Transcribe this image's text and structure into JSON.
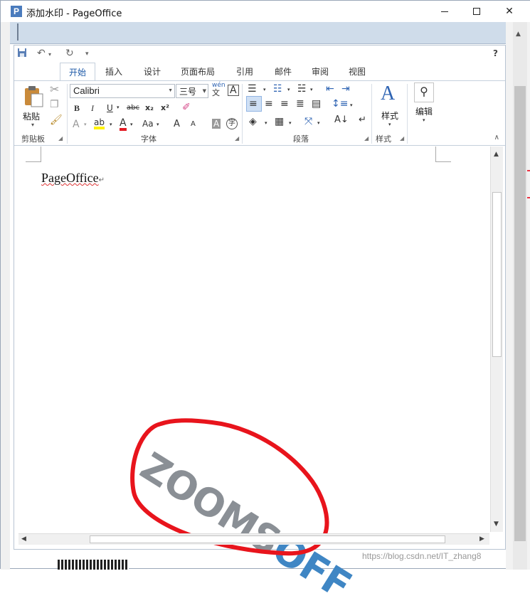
{
  "window": {
    "title": "添加水印 - PageOffice",
    "app_icon_letter": "P"
  },
  "qat": {
    "save_icon": "save-icon",
    "undo_icon": "undo-icon",
    "redo_icon": "redo-icon",
    "customize_icon": "customize-qat-icon",
    "help_label": "?"
  },
  "tabs": [
    {
      "label": "开始",
      "active": true
    },
    {
      "label": "插入"
    },
    {
      "label": "设计"
    },
    {
      "label": "页面布局"
    },
    {
      "label": "引用"
    },
    {
      "label": "邮件"
    },
    {
      "label": "审阅"
    },
    {
      "label": "视图"
    }
  ],
  "ribbon": {
    "clipboard": {
      "paste_label": "粘贴",
      "group_label": "剪贴板"
    },
    "font": {
      "font_name": "Calibri",
      "font_size": "三号",
      "group_label": "字体",
      "bold": "B",
      "italic": "I",
      "underline": "U",
      "strike": "abc",
      "subscript": "x₂",
      "superscript": "x²",
      "wen_top": "wén",
      "wen_bottom": "文",
      "font_color": "A",
      "case": "Aa",
      "grow": "A",
      "shrink": "A",
      "char_shade": "A",
      "enclose": "字"
    },
    "paragraph": {
      "group_label": "段落"
    },
    "styles": {
      "label": "样式",
      "group_label": "样式"
    },
    "editing": {
      "label": "编辑"
    }
  },
  "document": {
    "text": "PageOffice",
    "paragraph_mark": "↵",
    "watermark_gray": "ZOOMS",
    "watermark_blue": "OFF"
  },
  "overlay": {
    "csdn_url": "https://blog.csdn.net/IT_zhang8"
  },
  "colors": {
    "accent": "#2f64b3",
    "annotation": "#e8141c",
    "tab_active_text": "#1e5aa8"
  }
}
